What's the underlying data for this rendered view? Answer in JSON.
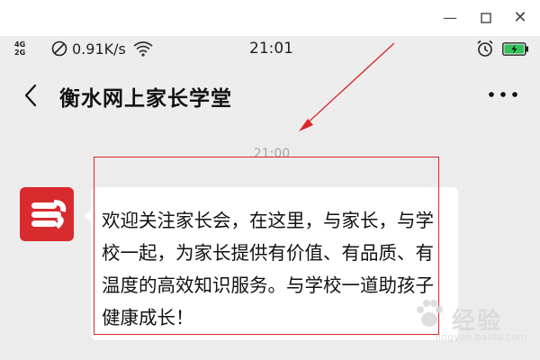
{
  "window": {
    "minimize_glyph": "—",
    "maximize_glyph": "☐",
    "close_glyph": "✕"
  },
  "status_bar": {
    "network_top": "4G",
    "network_bottom": "2G",
    "speed": "0.91K/s",
    "time": "21:01",
    "icons": [
      "no-sim-icon",
      "wifi-icon",
      "alarm-icon",
      "battery-charging-icon"
    ],
    "battery_color": "#33c15a"
  },
  "header": {
    "title": "衡水网上家长学堂",
    "back_icon": "chevron-left-icon",
    "more_icon": "more-dots-icon"
  },
  "chat": {
    "timestamp": "21:00",
    "avatar_color": "#d82b2e",
    "message": "欢迎关注家长会，在这里，与家长，与学校一起，为家长提供有价值、有品质、有温度的高效知识服务。与学校一道助孩子健康成长！"
  },
  "annotation": {
    "color": "#d8262a"
  },
  "watermark": {
    "text": "经验",
    "url": "jingyan.baidu.com"
  }
}
